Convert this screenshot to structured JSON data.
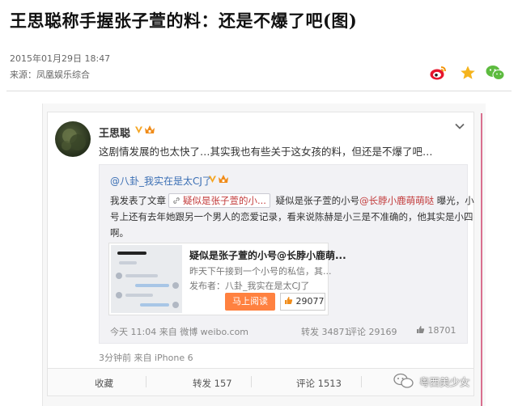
{
  "article": {
    "title": "王思聪称手握张子萱的料：还是不爆了吧(图)",
    "date": "2015年01月29日 18:47",
    "source": "来源：凤凰娱乐综合"
  },
  "share": {
    "weibo_icon": "weibo-icon",
    "star_icon": "star-icon",
    "wechat_icon": "wechat-icon"
  },
  "post": {
    "username": "王思聪",
    "text": "这剧情发展的也太快了…其实我也有些关于这女孩的料，但还是不爆了吧…",
    "time": "3分钟前 来自 iPhone 6",
    "actions": {
      "favorite": "收藏",
      "forward": "转发 157",
      "comment": "评论 1513"
    }
  },
  "repost": {
    "author": "@八卦_我实在是太CJ了",
    "line1_prefix": "我发表了文章",
    "chip_text": "疑似是张子萱的小...",
    "line1_mid": "疑似是张子萱的小号",
    "mention": "@长脖小鹿萌萌哒",
    "line1_suffix": "曝光，小",
    "line2": "号上还有去年她跟另一个男人的恋爱记录，看来说陈赫是小三是不准确的，他其实是小四",
    "line3": "啊。",
    "card": {
      "title": "疑似是张子萱的小号@长脖小鹿萌...",
      "desc": "昨天下午接到一个小号的私信，其...",
      "publisher": "发布者：八卦_我实在是太CJ了",
      "read_button": "马上阅读",
      "likes": "29077"
    },
    "time": "今天 11:04 来自 微博 weibo.com",
    "stats": {
      "repost": "转发 34871",
      "comment": "评论 29169",
      "likes": "18701"
    }
  },
  "watermark": "粤西美少女",
  "colors": {
    "accent_orange": "#ff8140",
    "link_blue": "#3b6fb4",
    "frame_pink": "#d9708f"
  }
}
